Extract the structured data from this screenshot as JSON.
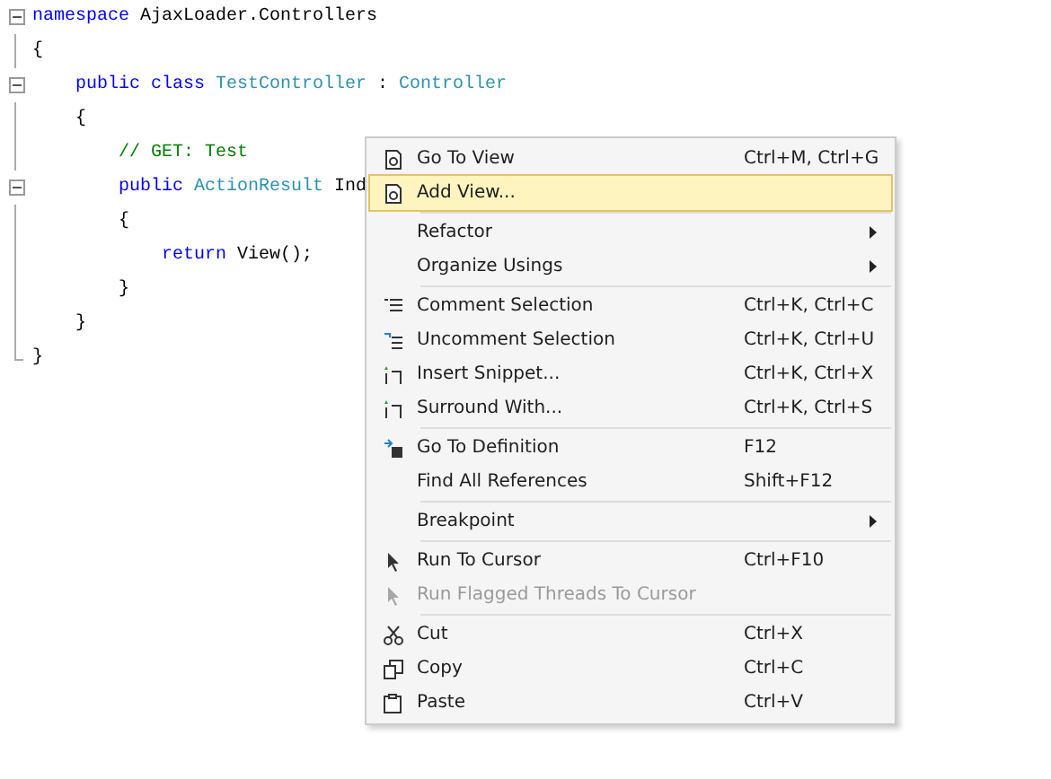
{
  "code": [
    {
      "tokens": [
        {
          "kind": "keyword",
          "text": "namespace"
        },
        {
          "kind": "plain",
          "text": " AjaxLoader.Controllers"
        }
      ],
      "open": "{",
      "close": "}",
      "children": [
        {
          "tokens": [
            {
              "kind": "keyword",
              "text": "public class"
            },
            {
              "kind": "type",
              "text": " TestController"
            },
            {
              "kind": "plain",
              "text": " : "
            },
            {
              "kind": "type",
              "text": "Controller"
            }
          ],
          "open": "{",
          "close": "}",
          "children": [
            {
              "tokens": [
                {
                  "kind": "comment",
                  "text": "// GET: Test"
                }
              ]
            },
            {
              "tokens": [
                {
                  "kind": "keyword",
                  "text": "public"
                },
                {
                  "kind": "type",
                  "text": " ActionResult"
                },
                {
                  "kind": "plain",
                  "text": " Ind"
                }
              ],
              "open": "{",
              "close": "}",
              "children": [
                {
                  "tokens": [
                    {
                      "kind": "keyword",
                      "text": "return"
                    },
                    {
                      "kind": "plain",
                      "text": " View();"
                    }
                  ]
                }
              ]
            }
          ]
        }
      ]
    }
  ],
  "context_menu": [
    {
      "kind": "item",
      "label": "Go To View",
      "shortcut": "Ctrl+M, Ctrl+G",
      "selected": false,
      "disabled": false,
      "submenu": false
    },
    {
      "kind": "item",
      "label": "Add View...",
      "selected": true,
      "disabled": false,
      "submenu": false
    },
    {
      "kind": "separator"
    },
    {
      "kind": "item",
      "label": "Refactor",
      "selected": false,
      "disabled": false,
      "submenu": true
    },
    {
      "kind": "item",
      "label": "Organize Usings",
      "selected": false,
      "disabled": false,
      "submenu": true
    },
    {
      "kind": "separator"
    },
    {
      "kind": "item",
      "label": "Comment Selection",
      "shortcut": "Ctrl+K, Ctrl+C",
      "selected": false,
      "disabled": false,
      "submenu": false
    },
    {
      "kind": "item",
      "label": "Uncomment Selection",
      "shortcut": "Ctrl+K, Ctrl+U",
      "selected": false,
      "disabled": false,
      "submenu": false
    },
    {
      "kind": "item",
      "label": "Insert Snippet...",
      "shortcut": "Ctrl+K, Ctrl+X",
      "selected": false,
      "disabled": false,
      "submenu": false
    },
    {
      "kind": "item",
      "label": "Surround With...",
      "shortcut": "Ctrl+K, Ctrl+S",
      "selected": false,
      "disabled": false,
      "submenu": false
    },
    {
      "kind": "separator"
    },
    {
      "kind": "item",
      "label": "Go To Definition",
      "shortcut": "F12",
      "selected": false,
      "disabled": false,
      "submenu": false
    },
    {
      "kind": "item",
      "label": "Find All References",
      "shortcut": "Shift+F12",
      "selected": false,
      "disabled": false,
      "submenu": false
    },
    {
      "kind": "separator"
    },
    {
      "kind": "item",
      "label": "Breakpoint",
      "selected": false,
      "disabled": false,
      "submenu": true
    },
    {
      "kind": "separator"
    },
    {
      "kind": "item",
      "label": "Run To Cursor",
      "shortcut": "Ctrl+F10",
      "selected": false,
      "disabled": false,
      "submenu": false
    },
    {
      "kind": "item",
      "label": "Run Flagged Threads To Cursor",
      "selected": false,
      "disabled": true,
      "submenu": false
    },
    {
      "kind": "separator"
    },
    {
      "kind": "item",
      "label": "Cut",
      "shortcut": "Ctrl+X",
      "selected": false,
      "disabled": false,
      "submenu": false
    },
    {
      "kind": "item",
      "label": "Copy",
      "shortcut": "Ctrl+C",
      "selected": false,
      "disabled": false,
      "submenu": false
    },
    {
      "kind": "item",
      "label": "Paste",
      "shortcut": "Ctrl+V",
      "selected": false,
      "disabled": false,
      "submenu": false
    }
  ]
}
